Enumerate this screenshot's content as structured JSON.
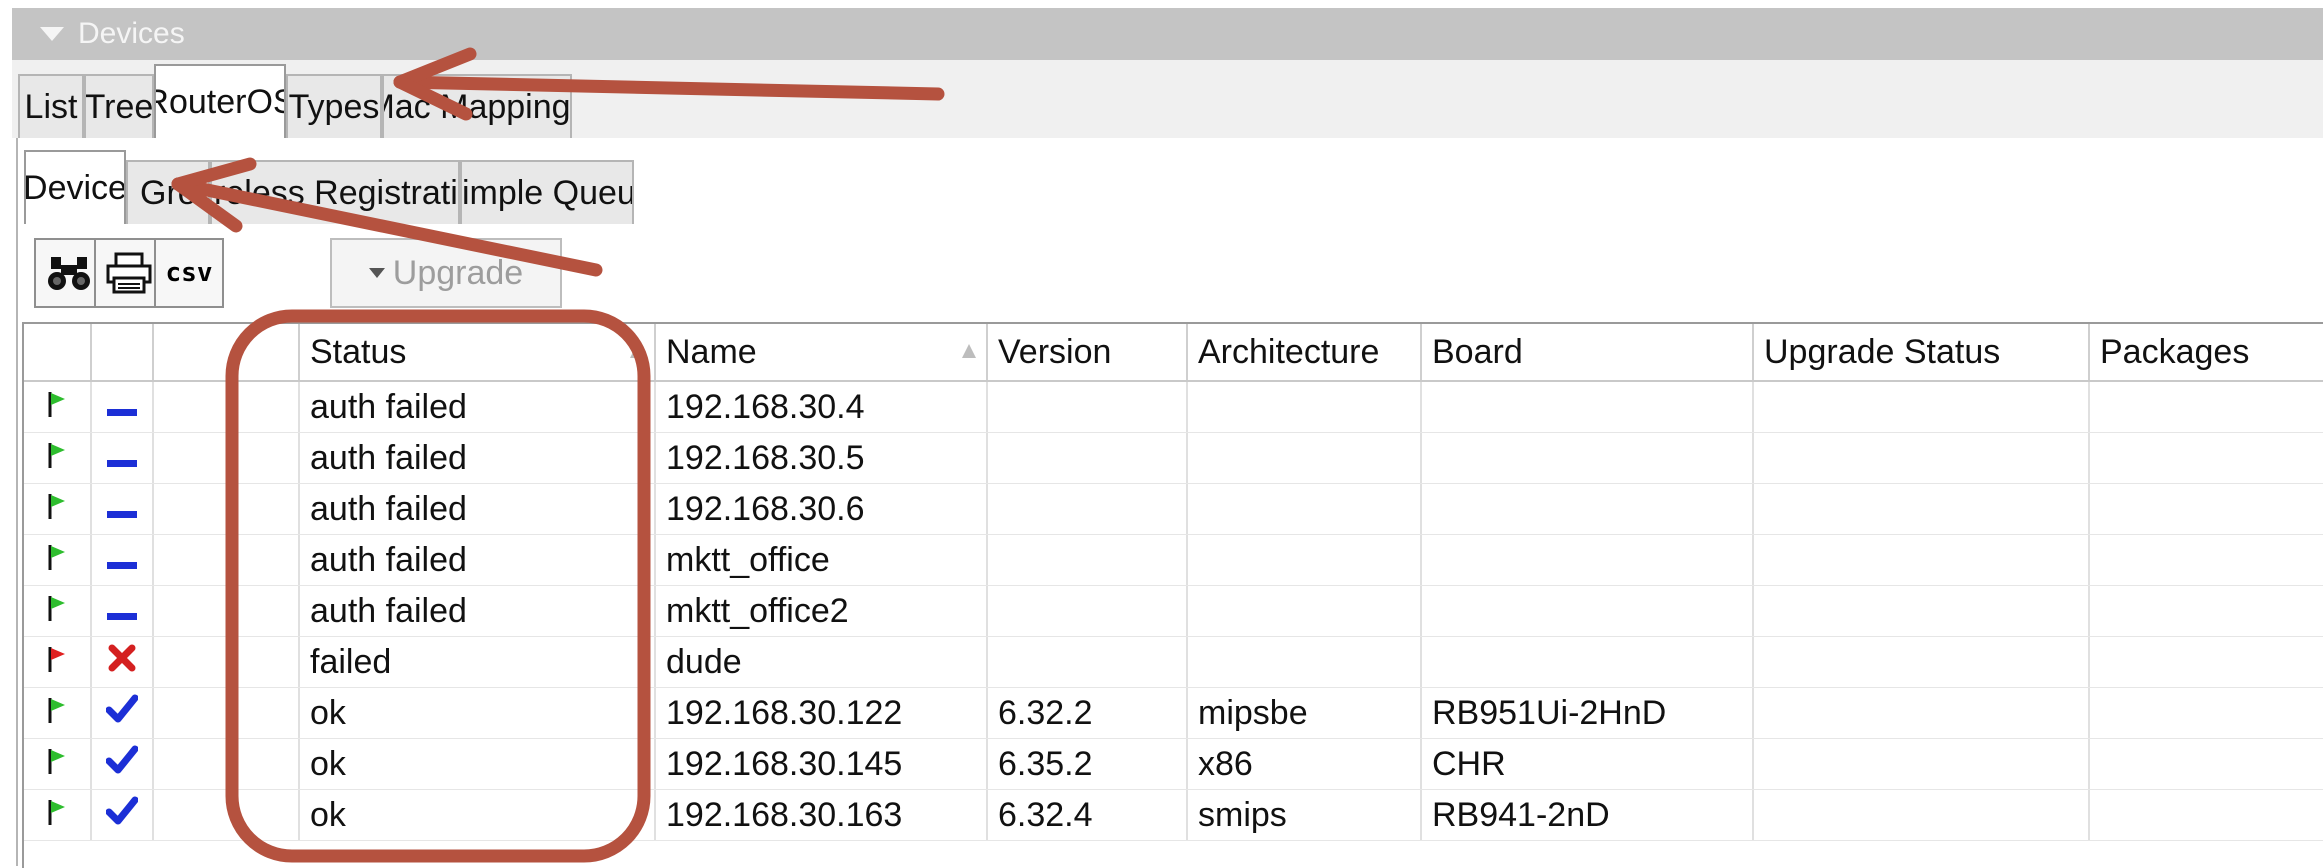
{
  "window": {
    "title": "Devices"
  },
  "tabs_top": [
    "List",
    "Tree",
    "RouterOS",
    "Types",
    "Mac Mappings"
  ],
  "tabs_sub": [
    "Device",
    "Group",
    "Wireless Registration",
    "Simple Queue"
  ],
  "toolbar": {
    "find_icon": "binoculars-icon",
    "print_icon": "printer-icon",
    "csv_label": "csv",
    "upgrade_label": "Upgrade"
  },
  "table": {
    "columns": [
      "",
      "",
      "",
      "Status",
      "Name",
      "Version",
      "Architecture",
      "Board",
      "Upgrade Status",
      "Packages"
    ],
    "rows": [
      {
        "flag": "green",
        "state": "dash",
        "status": "auth failed",
        "name": "192.168.30.4",
        "version": "",
        "architecture": "",
        "board": ""
      },
      {
        "flag": "green",
        "state": "dash",
        "status": "auth failed",
        "name": "192.168.30.5",
        "version": "",
        "architecture": "",
        "board": ""
      },
      {
        "flag": "green",
        "state": "dash",
        "status": "auth failed",
        "name": "192.168.30.6",
        "version": "",
        "architecture": "",
        "board": ""
      },
      {
        "flag": "green",
        "state": "dash",
        "status": "auth failed",
        "name": "mktt_office",
        "version": "",
        "architecture": "",
        "board": ""
      },
      {
        "flag": "green",
        "state": "dash",
        "status": "auth failed",
        "name": "mktt_office2",
        "version": "",
        "architecture": "",
        "board": ""
      },
      {
        "flag": "red",
        "state": "x",
        "status": "failed",
        "name": "dude",
        "version": "",
        "architecture": "",
        "board": ""
      },
      {
        "flag": "green",
        "state": "check",
        "status": "ok",
        "name": "192.168.30.122",
        "version": "6.32.2",
        "architecture": "mipsbe",
        "board": "RB951Ui-2HnD"
      },
      {
        "flag": "green",
        "state": "check",
        "status": "ok",
        "name": "192.168.30.145",
        "version": "6.35.2",
        "architecture": "x86",
        "board": "CHR"
      },
      {
        "flag": "green",
        "state": "check",
        "status": "ok",
        "name": "192.168.30.163",
        "version": "6.32.4",
        "architecture": "smips",
        "board": "RB941-2nD"
      }
    ]
  },
  "colors": {
    "annotation": "#b5523f",
    "flag_green": "#2ebd2e",
    "flag_red": "#e02020",
    "dash": "#1c2fd6",
    "check": "#1c2fd6",
    "x": "#d42020"
  }
}
